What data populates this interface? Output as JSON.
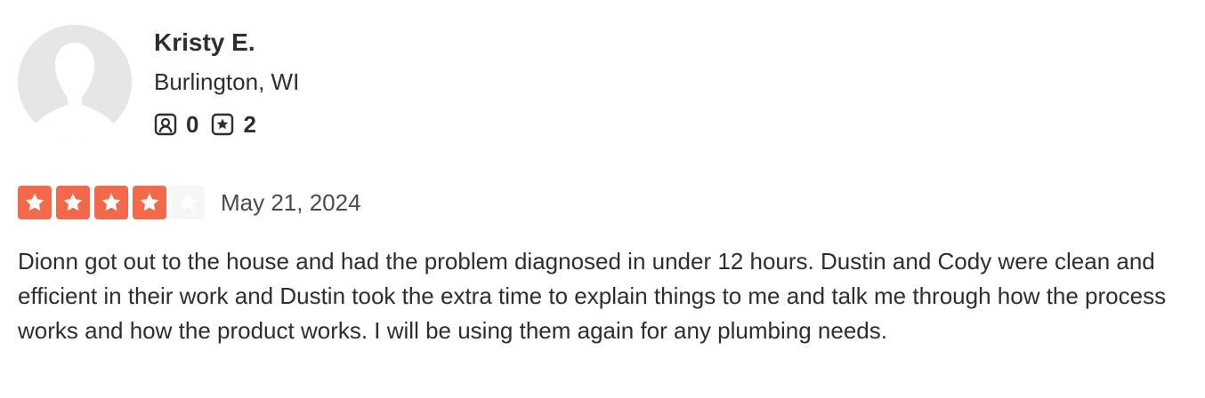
{
  "reviewer": {
    "name": "Kristy E.",
    "location": "Burlington, WI",
    "avatar_icon": "default-user-silhouette-icon",
    "stats": {
      "friends_icon": "friends-icon",
      "friends_count": "0",
      "reviews_icon": "review-star-icon",
      "reviews_count": "2"
    }
  },
  "review": {
    "rating": 4,
    "max_rating": 5,
    "star_color": "#f4694a",
    "empty_star_color": "#f6f6f7",
    "date": "May 21, 2024",
    "text": "Dionn got out to the house and had the problem diagnosed in under 12 hours. Dustin and Cody were clean and efficient in their work and Dustin took the extra time to explain things to me and talk me through how the process works and how the product works. I will be using them again for any plumbing needs."
  }
}
